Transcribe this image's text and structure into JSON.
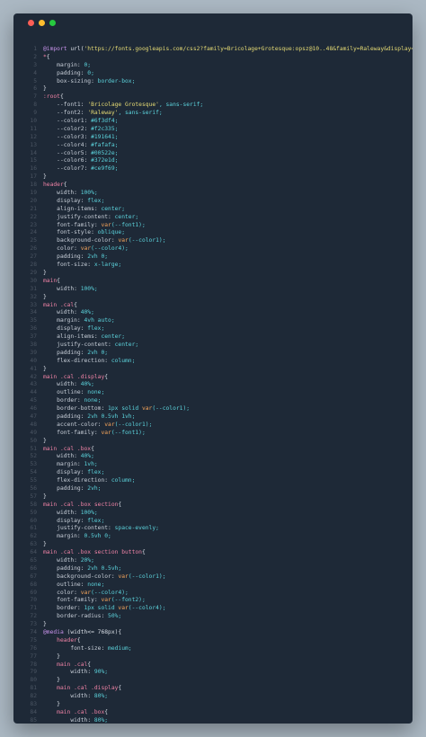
{
  "window": {
    "colors": {
      "background": "#1e2937",
      "page": "#abb8c3"
    },
    "controls": [
      "close-dot",
      "minimize-dot",
      "zoom-dot"
    ]
  },
  "code_lines": [
    "@import url('https://fonts.googleapis.com/css2?family=Bricolage+Grotesque:opsz@10..48&family=Raleway&display=swap');",
    "*{",
    "    margin: 0;",
    "    padding: 0;",
    "    box-sizing: border-box;",
    "}",
    ":root{",
    "    --font1: 'Bricolage Grotesque', sans-serif;",
    "    --font2: 'Raleway', sans-serif;",
    "    --color1: #6f3df4;",
    "    --color2: #f2c335;",
    "    --color3: #191641;",
    "    --color4: #fafafa;",
    "    --color5: #00522e;",
    "    --color6: #372e1d;",
    "    --color7: #ce9f69;",
    "}",
    "header{",
    "    width: 100%;",
    "    display: flex;",
    "    align-items: center;",
    "    justify-content: center;",
    "    font-family: var(--font1);",
    "    font-style: oblique;",
    "    background-color: var(--color1);",
    "    color: var(--color4);",
    "    padding: 2vh 0;",
    "    font-size: x-large;",
    "}",
    "main{",
    "    width: 100%;",
    "}",
    "main .cal{",
    "    width: 40%;",
    "    margin: 4vh auto;",
    "    display: flex;",
    "    align-items: center;",
    "    justify-content: center;",
    "    padding: 2vh 0;",
    "    flex-direction: column;",
    "}",
    "main .cal .display{",
    "    width: 40%;",
    "    outline: none;",
    "    border: none;",
    "    border-bottom: 1px solid var(--color1);",
    "    padding: 2vh 0.5vh 1vh;",
    "    accent-color: var(--color1);",
    "    font-family: var(--font1);",
    "}",
    "main .cal .box{",
    "    width: 40%;",
    "    margin: 1vh;",
    "    display: flex;",
    "    flex-direction: column;",
    "    padding: 2vh;",
    "}",
    "main .cal .box section{",
    "    width: 100%;",
    "    display: flex;",
    "    justify-content: space-evenly;",
    "    margin: 0.5vh 0;",
    "}",
    "main .cal .box section button{",
    "    width: 20%;",
    "    padding: 2vh 0.5vh;",
    "    background-color: var(--color1);",
    "    outline: none;",
    "    color: var(--color4);",
    "    font-family: var(--font2);",
    "    border: 1px solid var(--color4);",
    "    border-radius: 50%;",
    "}",
    "@media (width<= 768px){",
    "    header{",
    "        font-size: medium;",
    "    }",
    "    main .cal{",
    "        width: 90%;",
    "    }",
    "    main .cal .display{",
    "        width: 80%;",
    "    }",
    "    main .cal .box{",
    "        width: 80%;",
    "    }",
    "}"
  ]
}
